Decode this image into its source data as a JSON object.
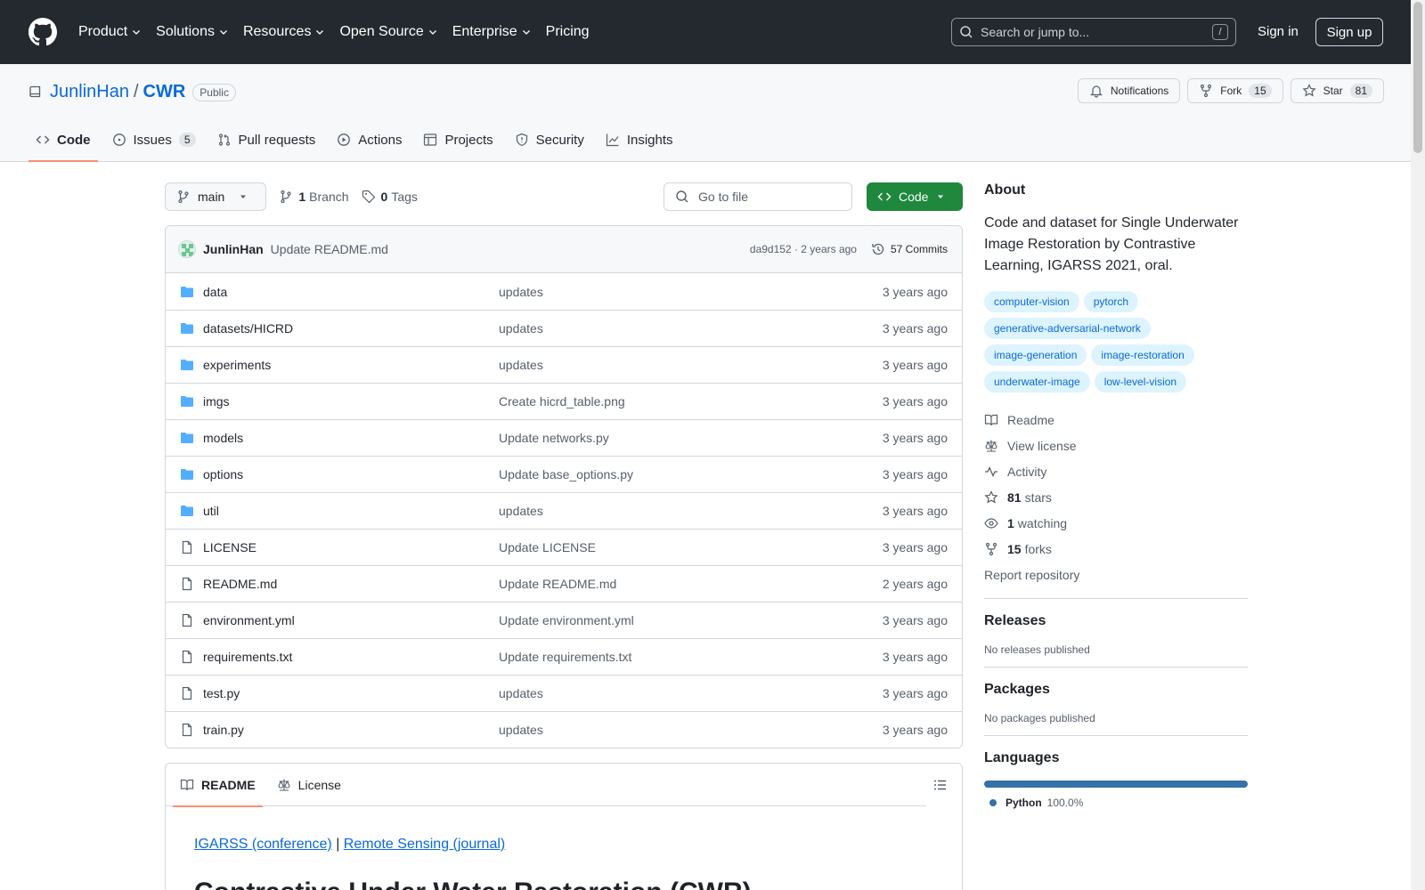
{
  "header": {
    "nav": [
      "Product",
      "Solutions",
      "Resources",
      "Open Source",
      "Enterprise",
      "Pricing"
    ],
    "search_placeholder": "Search or jump to...",
    "search_kbd": "/",
    "signin": "Sign in",
    "signup": "Sign up"
  },
  "repo": {
    "owner": "JunlinHan",
    "name": "CWR",
    "visibility": "Public",
    "notifications": "Notifications",
    "fork_label": "Fork",
    "fork_count": "15",
    "star_label": "Star",
    "star_count": "81",
    "tabs": [
      {
        "label": "Code"
      },
      {
        "label": "Issues",
        "count": "5"
      },
      {
        "label": "Pull requests"
      },
      {
        "label": "Actions"
      },
      {
        "label": "Projects"
      },
      {
        "label": "Security"
      },
      {
        "label": "Insights"
      }
    ]
  },
  "toolbar": {
    "branch": "main",
    "branch_count": "1",
    "branch_label": "Branch",
    "tag_count": "0",
    "tag_label": "Tags",
    "goto_placeholder": "Go to file",
    "code_label": "Code"
  },
  "commit": {
    "author": "JunlinHan",
    "message": "Update README.md",
    "meta": "da9d152 · 2 years ago",
    "commits": "57 Commits"
  },
  "files": [
    {
      "type": "dir",
      "name": "data",
      "commit": "updates",
      "age": "3 years ago"
    },
    {
      "type": "dir",
      "name": "datasets/HICRD",
      "commit": "updates",
      "age": "3 years ago"
    },
    {
      "type": "dir",
      "name": "experiments",
      "commit": "updates",
      "age": "3 years ago"
    },
    {
      "type": "dir",
      "name": "imgs",
      "commit": "Create hicrd_table.png",
      "age": "3 years ago"
    },
    {
      "type": "dir",
      "name": "models",
      "commit": "Update networks.py",
      "age": "3 years ago"
    },
    {
      "type": "dir",
      "name": "options",
      "commit": "Update base_options.py",
      "age": "3 years ago"
    },
    {
      "type": "dir",
      "name": "util",
      "commit": "updates",
      "age": "3 years ago"
    },
    {
      "type": "file",
      "name": "LICENSE",
      "commit": "Update LICENSE",
      "age": "3 years ago"
    },
    {
      "type": "file",
      "name": "README.md",
      "commit": "Update README.md",
      "age": "2 years ago"
    },
    {
      "type": "file",
      "name": "environment.yml",
      "commit": "Update environment.yml",
      "age": "3 years ago"
    },
    {
      "type": "file",
      "name": "requirements.txt",
      "commit": "Update requirements.txt",
      "age": "3 years ago"
    },
    {
      "type": "file",
      "name": "test.py",
      "commit": "updates",
      "age": "3 years ago"
    },
    {
      "type": "file",
      "name": "train.py",
      "commit": "updates",
      "age": "3 years ago"
    }
  ],
  "readme": {
    "tab_readme": "README",
    "tab_license": "License",
    "link1": "IGARSS (conference)",
    "sep": "|",
    "link2": "Remote Sensing (journal)",
    "heading": "Contrastive Under Water Restoration (CWR)"
  },
  "about": {
    "title": "About",
    "description": "Code and dataset for Single Underwater Image Restoration by Contrastive Learning, IGARSS 2021, oral.",
    "topics": [
      "computer-vision",
      "pytorch",
      "generative-adversarial-network",
      "image-generation",
      "image-restoration",
      "underwater-image",
      "low-level-vision"
    ],
    "readme": "Readme",
    "license": "View license",
    "activity": "Activity",
    "stars_count": "81",
    "stars_label": "stars",
    "watching_count": "1",
    "watching_label": "watching",
    "forks_count": "15",
    "forks_label": "forks",
    "report": "Report repository"
  },
  "releases": {
    "title": "Releases",
    "text": "No releases published"
  },
  "packages": {
    "title": "Packages",
    "text": "No packages published"
  },
  "languages": {
    "title": "Languages",
    "name": "Python",
    "percent": "100.0%",
    "share": 1.0,
    "color": "#3572A5"
  }
}
